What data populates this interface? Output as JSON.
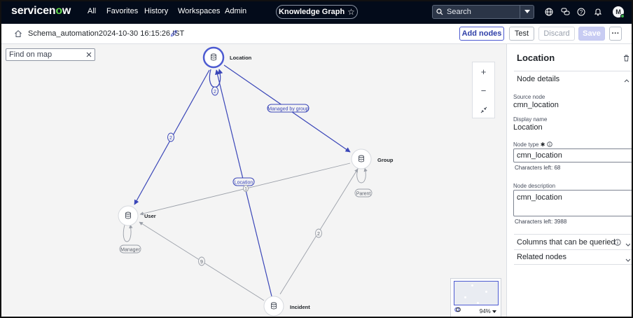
{
  "nav": {
    "logo": "servicenow",
    "items": [
      "All",
      "Favorites",
      "History",
      "Workspaces",
      "Admin"
    ],
    "pill_label": "Knowledge Graph",
    "search_placeholder": "Search",
    "avatar_initial": "M"
  },
  "toolbar": {
    "schema_title": "Schema_automation2024-10-30 16:15:26 IST",
    "add_nodes": "Add nodes",
    "test": "Test",
    "discard": "Discard",
    "save": "Save",
    "more": "···"
  },
  "canvas": {
    "find_placeholder": "Find on map",
    "zoom_in": "+",
    "zoom_out": "−",
    "zoom_level": "94%",
    "nodes": {
      "location": "Location",
      "group": "Group",
      "user": "User",
      "incident": "Incident"
    },
    "edge_labels": {
      "managed_by_group": "Managed by group",
      "location": "Location",
      "parent": "Parent",
      "manager": "Manager",
      "count_2a": "2",
      "count_2b": "2",
      "count_2c": "2",
      "count_9": "9",
      "count_1": "1"
    }
  },
  "panel": {
    "title": "Location",
    "node_details": "Node details",
    "source_node_label": "Source node",
    "source_node_value": "cmn_location",
    "display_name_label": "Display name",
    "display_name_value": "Location",
    "node_type_label": "Node type",
    "node_type_value": "cmn_location",
    "node_type_chars": "Characters left: 68",
    "node_desc_label": "Node description",
    "node_desc_value": "cmn_location",
    "node_desc_chars": "Characters left: 3988",
    "columns_queried": "Columns that can be queried",
    "related_nodes": "Related nodes"
  },
  "colors": {
    "nav_bg": "#030b1a",
    "accent": "#4d5bd1",
    "edge_active": "#3a46b8",
    "edge_inactive": "#9a9fa8",
    "canvas_bg": "#f4f4f4"
  }
}
